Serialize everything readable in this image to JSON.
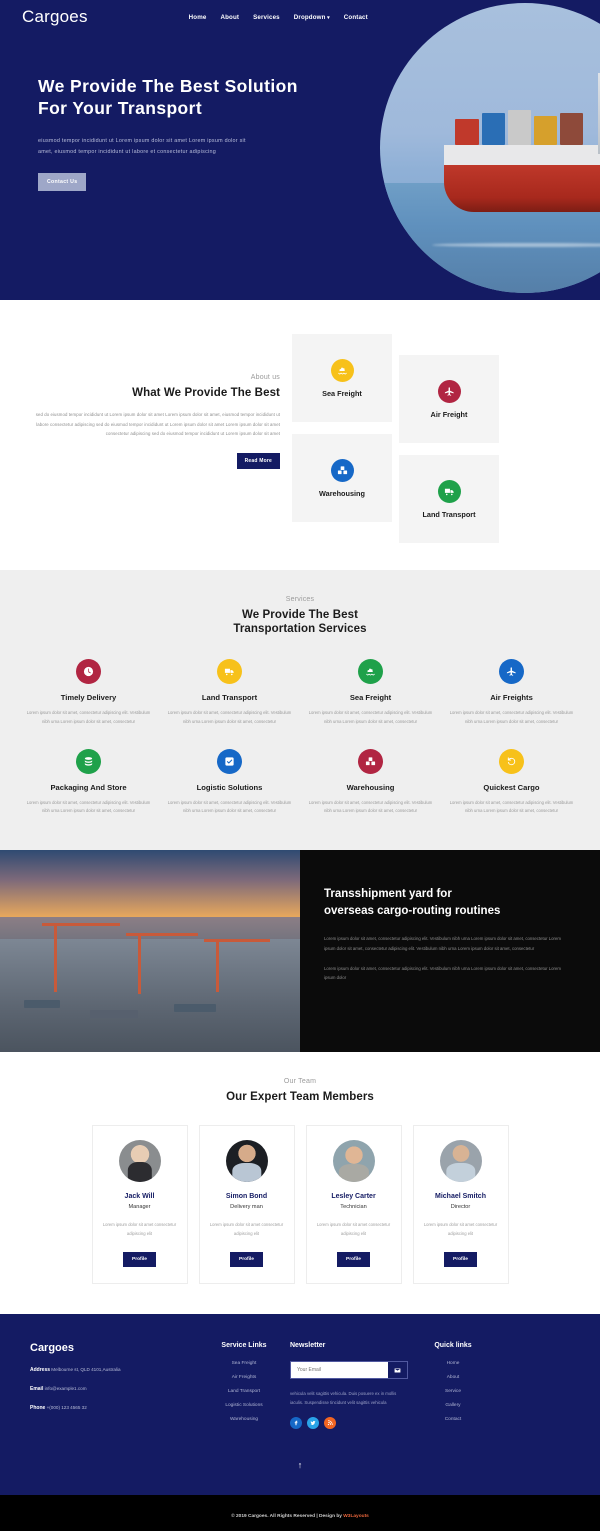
{
  "header": {
    "logo": "Cargoes",
    "nav": [
      {
        "label": "Home"
      },
      {
        "label": "About"
      },
      {
        "label": "Services"
      },
      {
        "label": "Dropdown",
        "caret": "⌄"
      },
      {
        "label": "Contact"
      }
    ]
  },
  "hero": {
    "title": "We Provide The Best Solution For Your Transport",
    "subtitle": "eiusmod tempor incididunt ut Lorem ipsum dolor sit amet Lorem ipsum dolor sit amet, eiusmod tempor incididunt ut labore et consectetur adipiscing",
    "cta": "Contact Us"
  },
  "about": {
    "eyebrow": "About us",
    "heading": "What We Provide The Best",
    "paragraph": "sed do eiusmod tempor incididunt ut Lorem ipsum dolor sit amet Lorem ipsum dolor sit amet, eiusmod tempor incididunt ut labore consectetur adipiscing sed do eiusmod tempor incididunt ut Lorem ipsum dolor sit amet Lorem ipsum dolor sit amet consectetur adipiscing sed do eiusmod tempor incididunt ut Lorem ipsum dolor sit amet",
    "button": "Read More",
    "cards": [
      {
        "label": "Sea Freight",
        "icon": "ship-icon",
        "color": "#f7c11a"
      },
      {
        "label": "Air Freight",
        "icon": "plane-icon",
        "color": "#b12542"
      },
      {
        "label": "Warehousing",
        "icon": "boxes-icon",
        "color": "#1668c7"
      },
      {
        "label": "Land Transport",
        "icon": "truck-icon",
        "color": "#1fa14a"
      }
    ]
  },
  "services": {
    "eyebrow": "Services",
    "heading_line1": "We Provide The Best",
    "heading_line2": "Transportation Services",
    "body": "Lorem ipsum dolor sit amet, consectetur adipiscing elit. Vestibulum nibh urna Lorem ipsum dolor sit amet, consectetur",
    "items": [
      {
        "title": "Timely Delivery",
        "icon": "clock-icon",
        "color": "#b12542"
      },
      {
        "title": "Land Transport",
        "icon": "truck-icon",
        "color": "#f7c11a"
      },
      {
        "title": "Sea Freight",
        "icon": "ship-icon",
        "color": "#1fa14a"
      },
      {
        "title": "Air Freights",
        "icon": "plane-icon",
        "color": "#1668c7"
      },
      {
        "title": "Packaging And Store",
        "icon": "database-icon",
        "color": "#1fa14a"
      },
      {
        "title": "Logistic Solutions",
        "icon": "check-circle-icon",
        "color": "#1668c7"
      },
      {
        "title": "Warehousing",
        "icon": "boxes-icon",
        "color": "#b12542"
      },
      {
        "title": "Quickest Cargo",
        "icon": "history-icon",
        "color": "#f7c11a"
      }
    ]
  },
  "transshipment": {
    "heading_line1": "Transshipment yard for",
    "heading_line2": "overseas cargo-routing routines",
    "paragraph1": "Lorem ipsum dolor sit amet, consectetur adipiscing elit. Vestibulum nibh urna Lorem ipsum dolor sit amet, consectetur Lorem ipsum dolor sit amet, consectetur adipiscing elit. Vestibulum nibh urna Lorem ipsum dolor sit amet, consectetur",
    "paragraph2": "Lorem ipsum dolor sit amet, consectetur adipiscing elit. Vestibulum nibh urna Lorem ipsum dolor sit amet, consectetur Lorem ipsum dolor"
  },
  "team": {
    "eyebrow": "Our Team",
    "heading": "Our Expert Team Members",
    "bio": "Lorem ipsum dolor sit amet consectetur adipiscing elit",
    "button": "Profile",
    "members": [
      {
        "name": "Jack Will",
        "role": "Manager"
      },
      {
        "name": "Simon Bond",
        "role": "Delivery man"
      },
      {
        "name": "Lesley Carter",
        "role": "Technician"
      },
      {
        "name": "Michael Smitch",
        "role": "Director"
      }
    ]
  },
  "footer": {
    "brand": "Cargoes",
    "address_label": "Address",
    "address_value": "Melbourne st, QLD 4101,Australia",
    "email_label": "Email",
    "email_value": "info@example1.com",
    "phone_label": "Phone",
    "phone_value": "+(000) 123 4565 32",
    "service_links_title": "Service Links",
    "service_links": [
      "Sea Freight",
      "Air Freights",
      "Land Transport",
      "Logistic Solutions",
      "Warehousing"
    ],
    "newsletter_title": "Newsletter",
    "newsletter_placeholder": "Your Email",
    "newsletter_text": "vehicula velit sagittis vehicula. Duis posuere ex in mollis iaculis. Suspendisse tincidunt velit sagittis vehicula",
    "socials": [
      {
        "name": "facebook-icon",
        "color": "#1668c7"
      },
      {
        "name": "twitter-icon",
        "color": "#2aa3e8"
      },
      {
        "name": "rss-icon",
        "color": "#f26522"
      }
    ],
    "quick_links_title": "Quick links",
    "quick_links": [
      "Home",
      "About",
      "Service",
      "Gallery",
      "Contact"
    ],
    "to_top": "↑",
    "copyright_prefix": "© 2019 Cargoes. All Rights Reserved | Design by ",
    "copyright_brand": "W3Layouts"
  }
}
